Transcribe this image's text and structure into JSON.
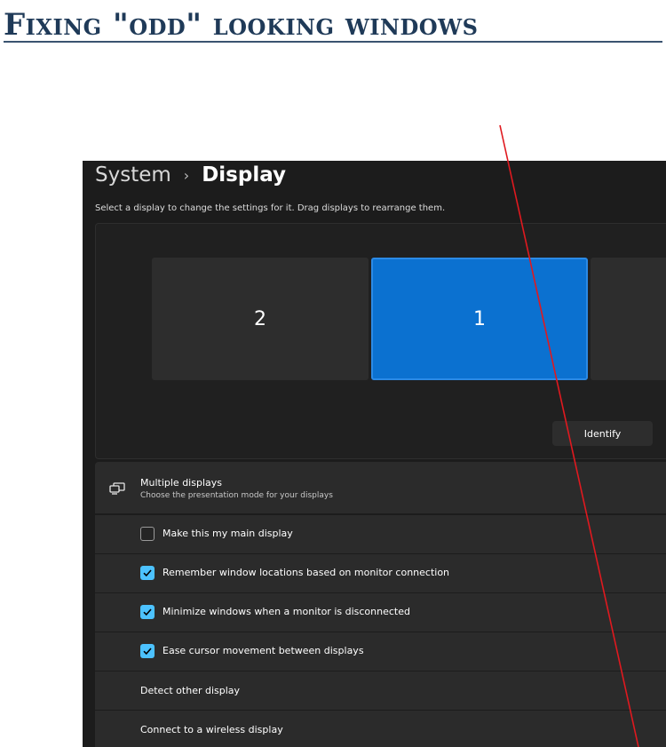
{
  "slide": {
    "title": "Fixing \"odd\" looking windows"
  },
  "header": {
    "breadcrumb_parent": "System",
    "breadcrumb_separator": "›",
    "breadcrumb_current": "Display"
  },
  "instructions": "Select a display to change the settings for it. Drag displays to rearrange them.",
  "monitors": [
    {
      "label": "2",
      "selected": false
    },
    {
      "label": "1",
      "selected": true
    },
    {
      "label": "",
      "selected": false
    }
  ],
  "identify_label": "Identify",
  "multiple_displays": {
    "icon": "multiple-displays-icon",
    "title": "Multiple displays",
    "subtitle": "Choose the presentation mode for your displays",
    "options": [
      {
        "label": "Make this my main display",
        "checked": false
      },
      {
        "label": "Remember window locations based on monitor connection",
        "checked": true
      },
      {
        "label": "Minimize windows when a monitor is disconnected",
        "checked": true
      },
      {
        "label": "Ease cursor movement between displays",
        "checked": true
      }
    ],
    "detect_label": "Detect other display",
    "connect_label": "Connect to a wireless display"
  },
  "colors": {
    "accent": "#0b71d0",
    "checkbox": "#4cc2ff",
    "annotation_line": "#e0191f",
    "title": "#1f3a58",
    "background": "#1c1c1c"
  }
}
